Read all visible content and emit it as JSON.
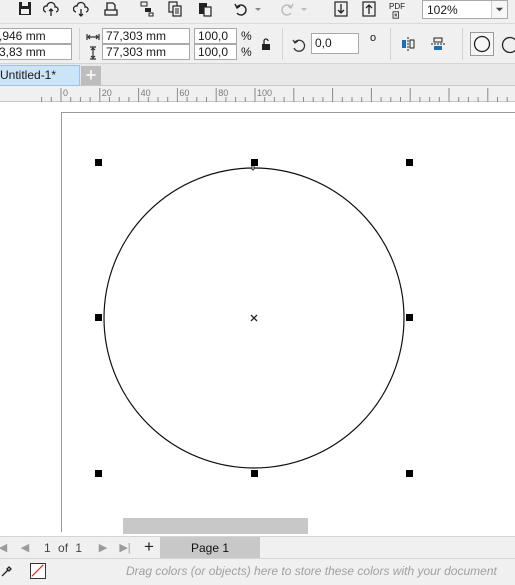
{
  "toolbar": {
    "zoom_value": "102%",
    "pdf_label": "PDF"
  },
  "propbar": {
    "x_value": ",946 mm",
    "y_value": "3,83 mm",
    "width_value": "77,303 mm",
    "height_value": "77,303 mm",
    "scale_w": "100,0",
    "scale_h": "100,0",
    "percent_sign": "%",
    "rotation_value": "0,0",
    "degree_sign": "o"
  },
  "document": {
    "tab_title": "Untitled-1*",
    "add_tab": "+"
  },
  "ruler": {
    "labels": [
      "0",
      "20",
      "40",
      "60",
      "80",
      "100"
    ]
  },
  "pagenav": {
    "current": "1",
    "of_label": "of",
    "total": "1",
    "add_page": "+",
    "page_tab": "Page 1"
  },
  "colorbar": {
    "hint": "Drag colors (or objects) here to store these colors with your document"
  }
}
